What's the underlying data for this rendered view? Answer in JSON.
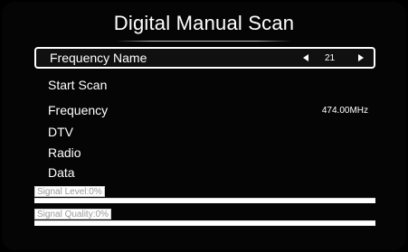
{
  "title": "Digital Manual Scan",
  "menu": {
    "frequency_name": {
      "label": "Frequency Name",
      "value": "21"
    },
    "start_scan": {
      "label": "Start Scan"
    },
    "frequency": {
      "label": "Frequency",
      "value": "474.00MHz"
    },
    "dtv": {
      "label": "DTV"
    },
    "radio": {
      "label": "Radio"
    },
    "data": {
      "label": "Data"
    }
  },
  "signal": {
    "level_label": "Signal Level:0%",
    "level_percent": 0,
    "quality_label": "Signal Quality:0%",
    "quality_percent": 0
  }
}
